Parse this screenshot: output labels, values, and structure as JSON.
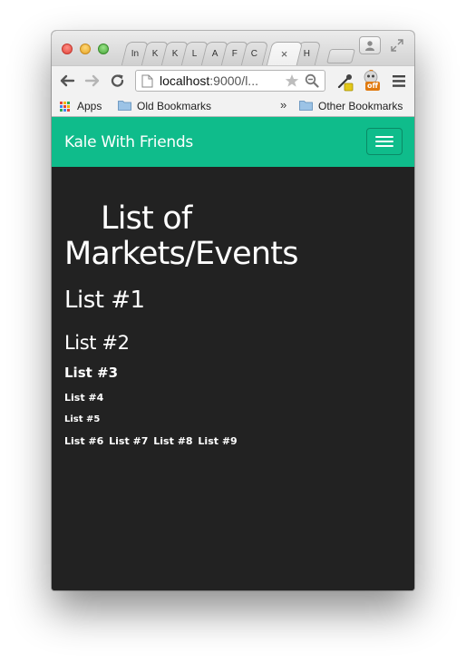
{
  "browser": {
    "tabs": [
      "In",
      "K",
      "K",
      "L",
      "A",
      "F",
      "C",
      "",
      "H"
    ],
    "active_tab_index": 7,
    "active_tab_close": "×",
    "url_host": "localhost",
    "url_rest": ":9000/l...",
    "extension_badge": "off",
    "bookmarks": {
      "apps": "Apps",
      "old": "Old Bookmarks",
      "more": "»",
      "other": "Other Bookmarks"
    }
  },
  "navbar": {
    "brand": "Kale With Friends",
    "brand_color": "#0fbc8b"
  },
  "page": {
    "background": "#222222",
    "title": "List of Markets/Events",
    "lists": [
      "List #1",
      "List #2",
      "List #3",
      "List #4",
      "List #5"
    ],
    "inline_lists": [
      "List #6",
      "List #7",
      "List #8",
      "List #9"
    ]
  }
}
